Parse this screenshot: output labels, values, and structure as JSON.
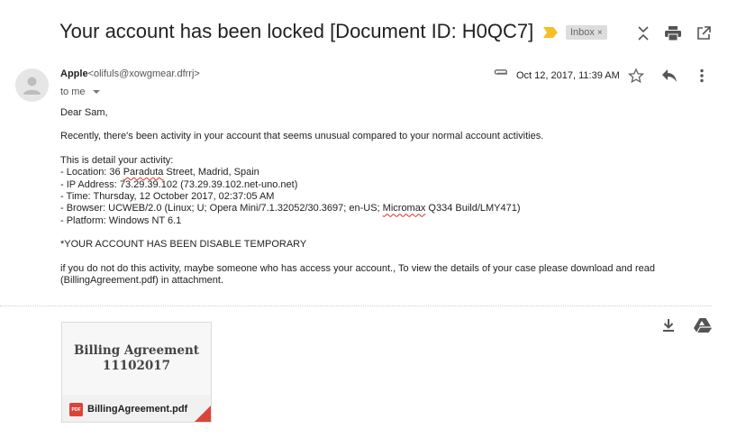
{
  "email": {
    "subject": "Your account has been locked [Document ID: H0QC7]",
    "label": "Inbox",
    "label_close": "×",
    "sender_name": "Apple",
    "sender_email": "<olifuls@xowgmear.dfrrj>",
    "to_line": "to me",
    "date": "Oct 12, 2017, 11:39 AM",
    "greeting": "Dear Sam,",
    "line_intro": "Recently, there's been activity in your account that seems unusual compared to your normal account activities.",
    "detail_header": "This is detail your activity:",
    "loc_a": "- Location: 36 ",
    "loc_b": "Paraduta",
    "loc_c": " Street, Madrid, Spain",
    "ip": "- IP Address: 73.29.39.102 (73.29.39.102.net-uno.net)",
    "time": "- Time: Thursday, 12 October 2017, 02:37:05 AM",
    "br_a": "- Browser: UCWEB/2.0 (Linux; U; Opera Mini/7.1.32052/30.3697; en-US; ",
    "br_b": "Micromax",
    "br_c": " Q334 Build/LMY471)",
    "platform": "- Platform: Windows NT 6.1",
    "warning": "*YOUR ACCOUNT HAS BEEN DISABLE TEMPORARY",
    "closing1": "if you do not do this activity, maybe someone who has access your account., To view the details of your case please download and read",
    "closing2": "(BillingAgreement.pdf) in attachment."
  },
  "attachment": {
    "preview_line1": "Billing Agreement",
    "preview_line2": "11102017",
    "file_type": "PDF",
    "filename": "BillingAgreement.pdf"
  },
  "icons": {
    "importance": "importance-marker-icon",
    "expand": "expand-collapse-icon",
    "print": "print-icon",
    "popout": "open-new-window-icon",
    "attach": "paperclip-icon",
    "star": "star-icon",
    "reply": "reply-icon",
    "more": "more-vert-icon",
    "download": "download-icon",
    "drive": "save-to-drive-icon"
  },
  "colors": {
    "importance": "#f6bf26",
    "pdf_red": "#db4437",
    "badge_bg": "#dddddd"
  }
}
